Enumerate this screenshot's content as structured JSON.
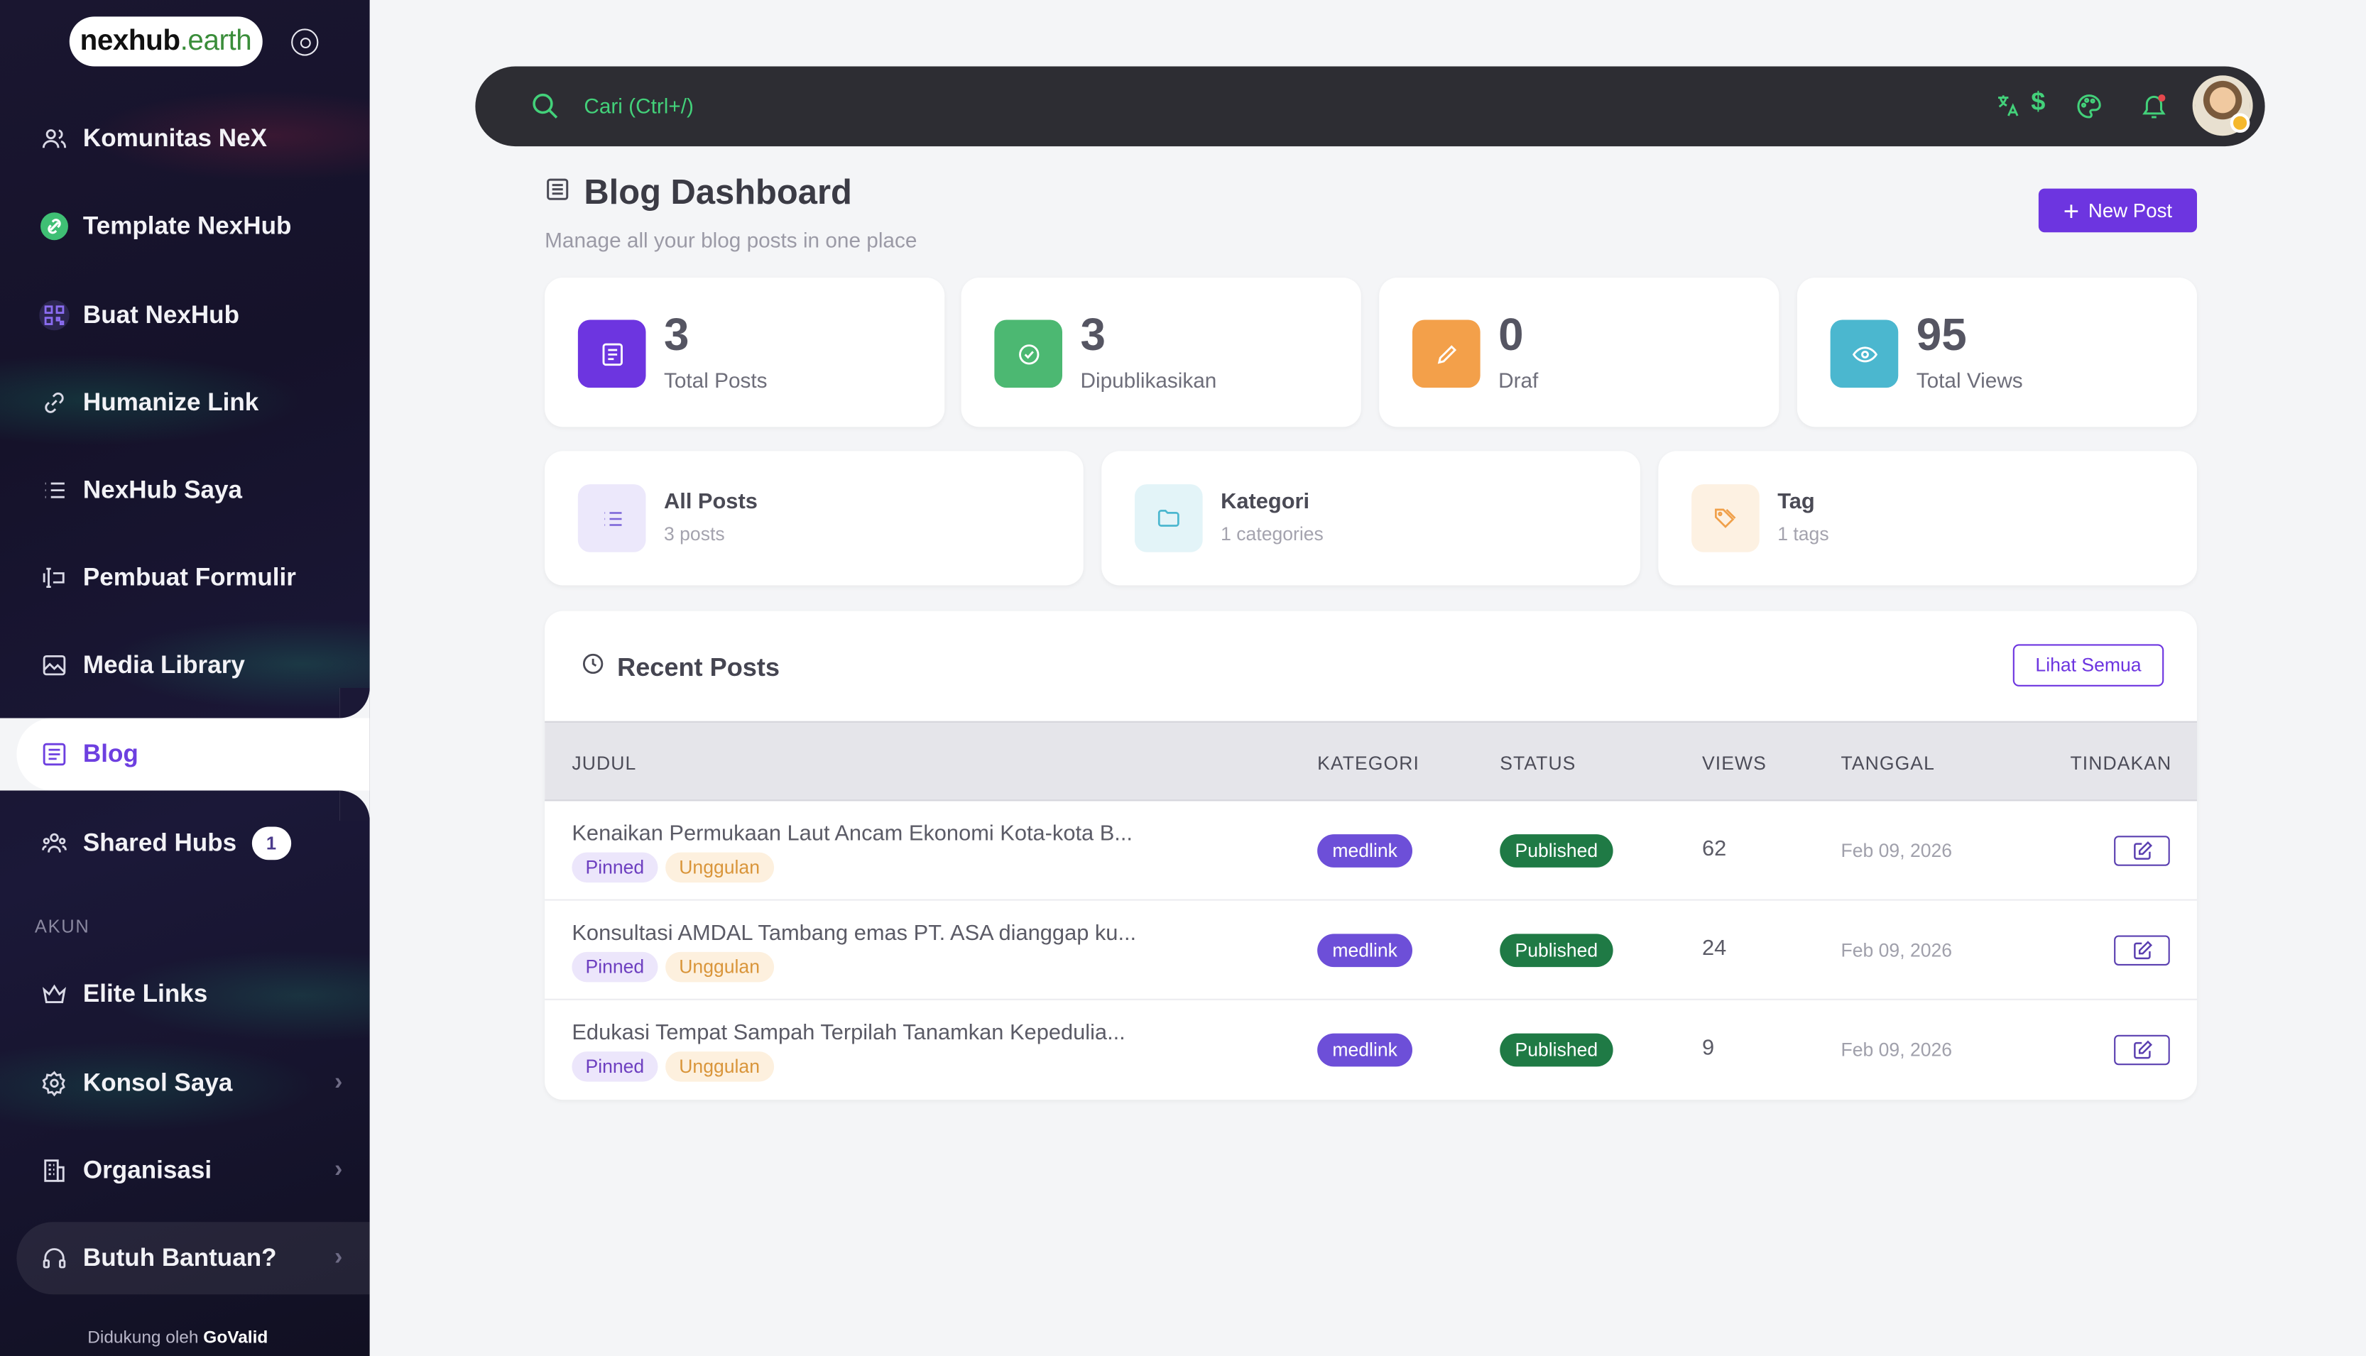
{
  "brand": {
    "logo_main": "nexhub",
    "logo_tld": ".earth"
  },
  "sidebar": {
    "items": [
      {
        "label": "Komunitas NeX"
      },
      {
        "label": "Template NexHub"
      },
      {
        "label": "Buat NexHub"
      },
      {
        "label": "Humanize Link"
      },
      {
        "label": "NexHub Saya"
      },
      {
        "label": "Pembuat Formulir"
      },
      {
        "label": "Media Library"
      },
      {
        "label": "Blog"
      },
      {
        "label": "Shared Hubs",
        "badge": "1"
      }
    ],
    "section_label": "AKUN",
    "account_items": [
      {
        "label": "Elite Links"
      },
      {
        "label": "Konsol Saya"
      },
      {
        "label": "Organisasi"
      }
    ],
    "help_label": "Butuh Bantuan?",
    "footer_prefix": "Didukung oleh",
    "footer_brand": "GoValid"
  },
  "topbar": {
    "search_placeholder": "Cari (Ctrl+/)"
  },
  "page": {
    "title": "Blog Dashboard",
    "subtitle": "Manage all your blog posts in one place",
    "new_post_label": "New Post"
  },
  "stats": [
    {
      "value": "3",
      "label": "Total Posts",
      "color": "#6d35e0"
    },
    {
      "value": "3",
      "label": "Dipublikasikan",
      "color": "#4cb872"
    },
    {
      "value": "0",
      "label": "Draf",
      "color": "#f3a04a"
    },
    {
      "value": "95",
      "label": "Total Views",
      "color": "#4bb7cf"
    }
  ],
  "links": [
    {
      "title": "All Posts",
      "sub": "3 posts"
    },
    {
      "title": "Kategori",
      "sub": "1 categories"
    },
    {
      "title": "Tag",
      "sub": "1 tags"
    }
  ],
  "recent": {
    "title": "Recent Posts",
    "see_all": "Lihat Semua",
    "columns": [
      "JUDUL",
      "KATEGORI",
      "STATUS",
      "VIEWS",
      "TANGGAL",
      "TINDAKAN"
    ],
    "rows": [
      {
        "title": "Kenaikan Permukaan Laut Ancam Ekonomi Kota-kota B...",
        "tag1": "Pinned",
        "tag2": "Unggulan",
        "category": "medlink",
        "status": "Published",
        "views": "62",
        "date": "Feb 09, 2026"
      },
      {
        "title": "Konsultasi AMDAL Tambang emas PT. ASA dianggap ku...",
        "tag1": "Pinned",
        "tag2": "Unggulan",
        "category": "medlink",
        "status": "Published",
        "views": "24",
        "date": "Feb 09, 2026"
      },
      {
        "title": "Edukasi Tempat Sampah Terpilah Tanamkan Kepedulia...",
        "tag1": "Pinned",
        "tag2": "Unggulan",
        "category": "medlink",
        "status": "Published",
        "views": "9",
        "date": "Feb 09, 2026"
      }
    ]
  }
}
